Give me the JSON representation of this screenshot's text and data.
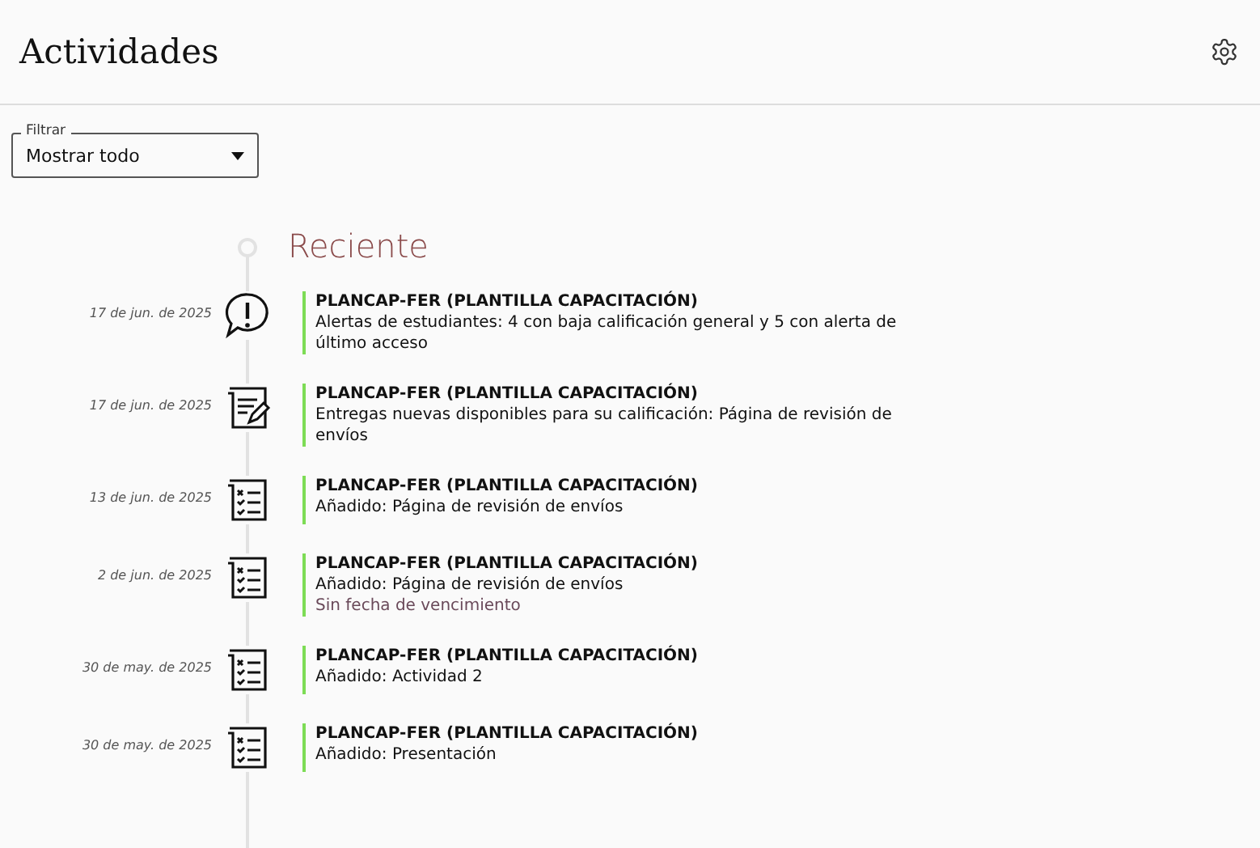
{
  "header": {
    "title": "Actividades"
  },
  "filter": {
    "label": "Filtrar",
    "value": "Mostrar todo"
  },
  "section": {
    "title": "Reciente"
  },
  "activities": [
    {
      "date": "17 de jun. de 2025",
      "kind": "alert",
      "course": "PLANCAP-FER (PLANTILLA CAPACITACIÓN)",
      "description": "Alertas de estudiantes: 4 con baja calificación general y 5 con alerta de último acceso"
    },
    {
      "date": "17 de jun. de 2025",
      "kind": "grading",
      "course": "PLANCAP-FER (PLANTILLA CAPACITACIÓN)",
      "description": "Entregas nuevas disponibles para su calificación: Página de revisión de envíos"
    },
    {
      "date": "13 de jun. de 2025",
      "kind": "checklist",
      "course": "PLANCAP-FER (PLANTILLA CAPACITACIÓN)",
      "description": "Añadido: Página de revisión de envíos"
    },
    {
      "date": "2 de jun. de 2025",
      "kind": "checklist",
      "course": "PLANCAP-FER (PLANTILLA CAPACITACIÓN)",
      "description": "Añadido: Página de revisión de envíos",
      "note": "Sin fecha de vencimiento"
    },
    {
      "date": "30 de may. de 2025",
      "kind": "checklist",
      "course": "PLANCAP-FER (PLANTILLA CAPACITACIÓN)",
      "description": "Añadido: Actividad 2"
    },
    {
      "date": "30 de may. de 2025",
      "kind": "checklist",
      "course": "PLANCAP-FER (PLANTILLA CAPACITACIÓN)",
      "description": "Añadido: Presentación"
    }
  ]
}
